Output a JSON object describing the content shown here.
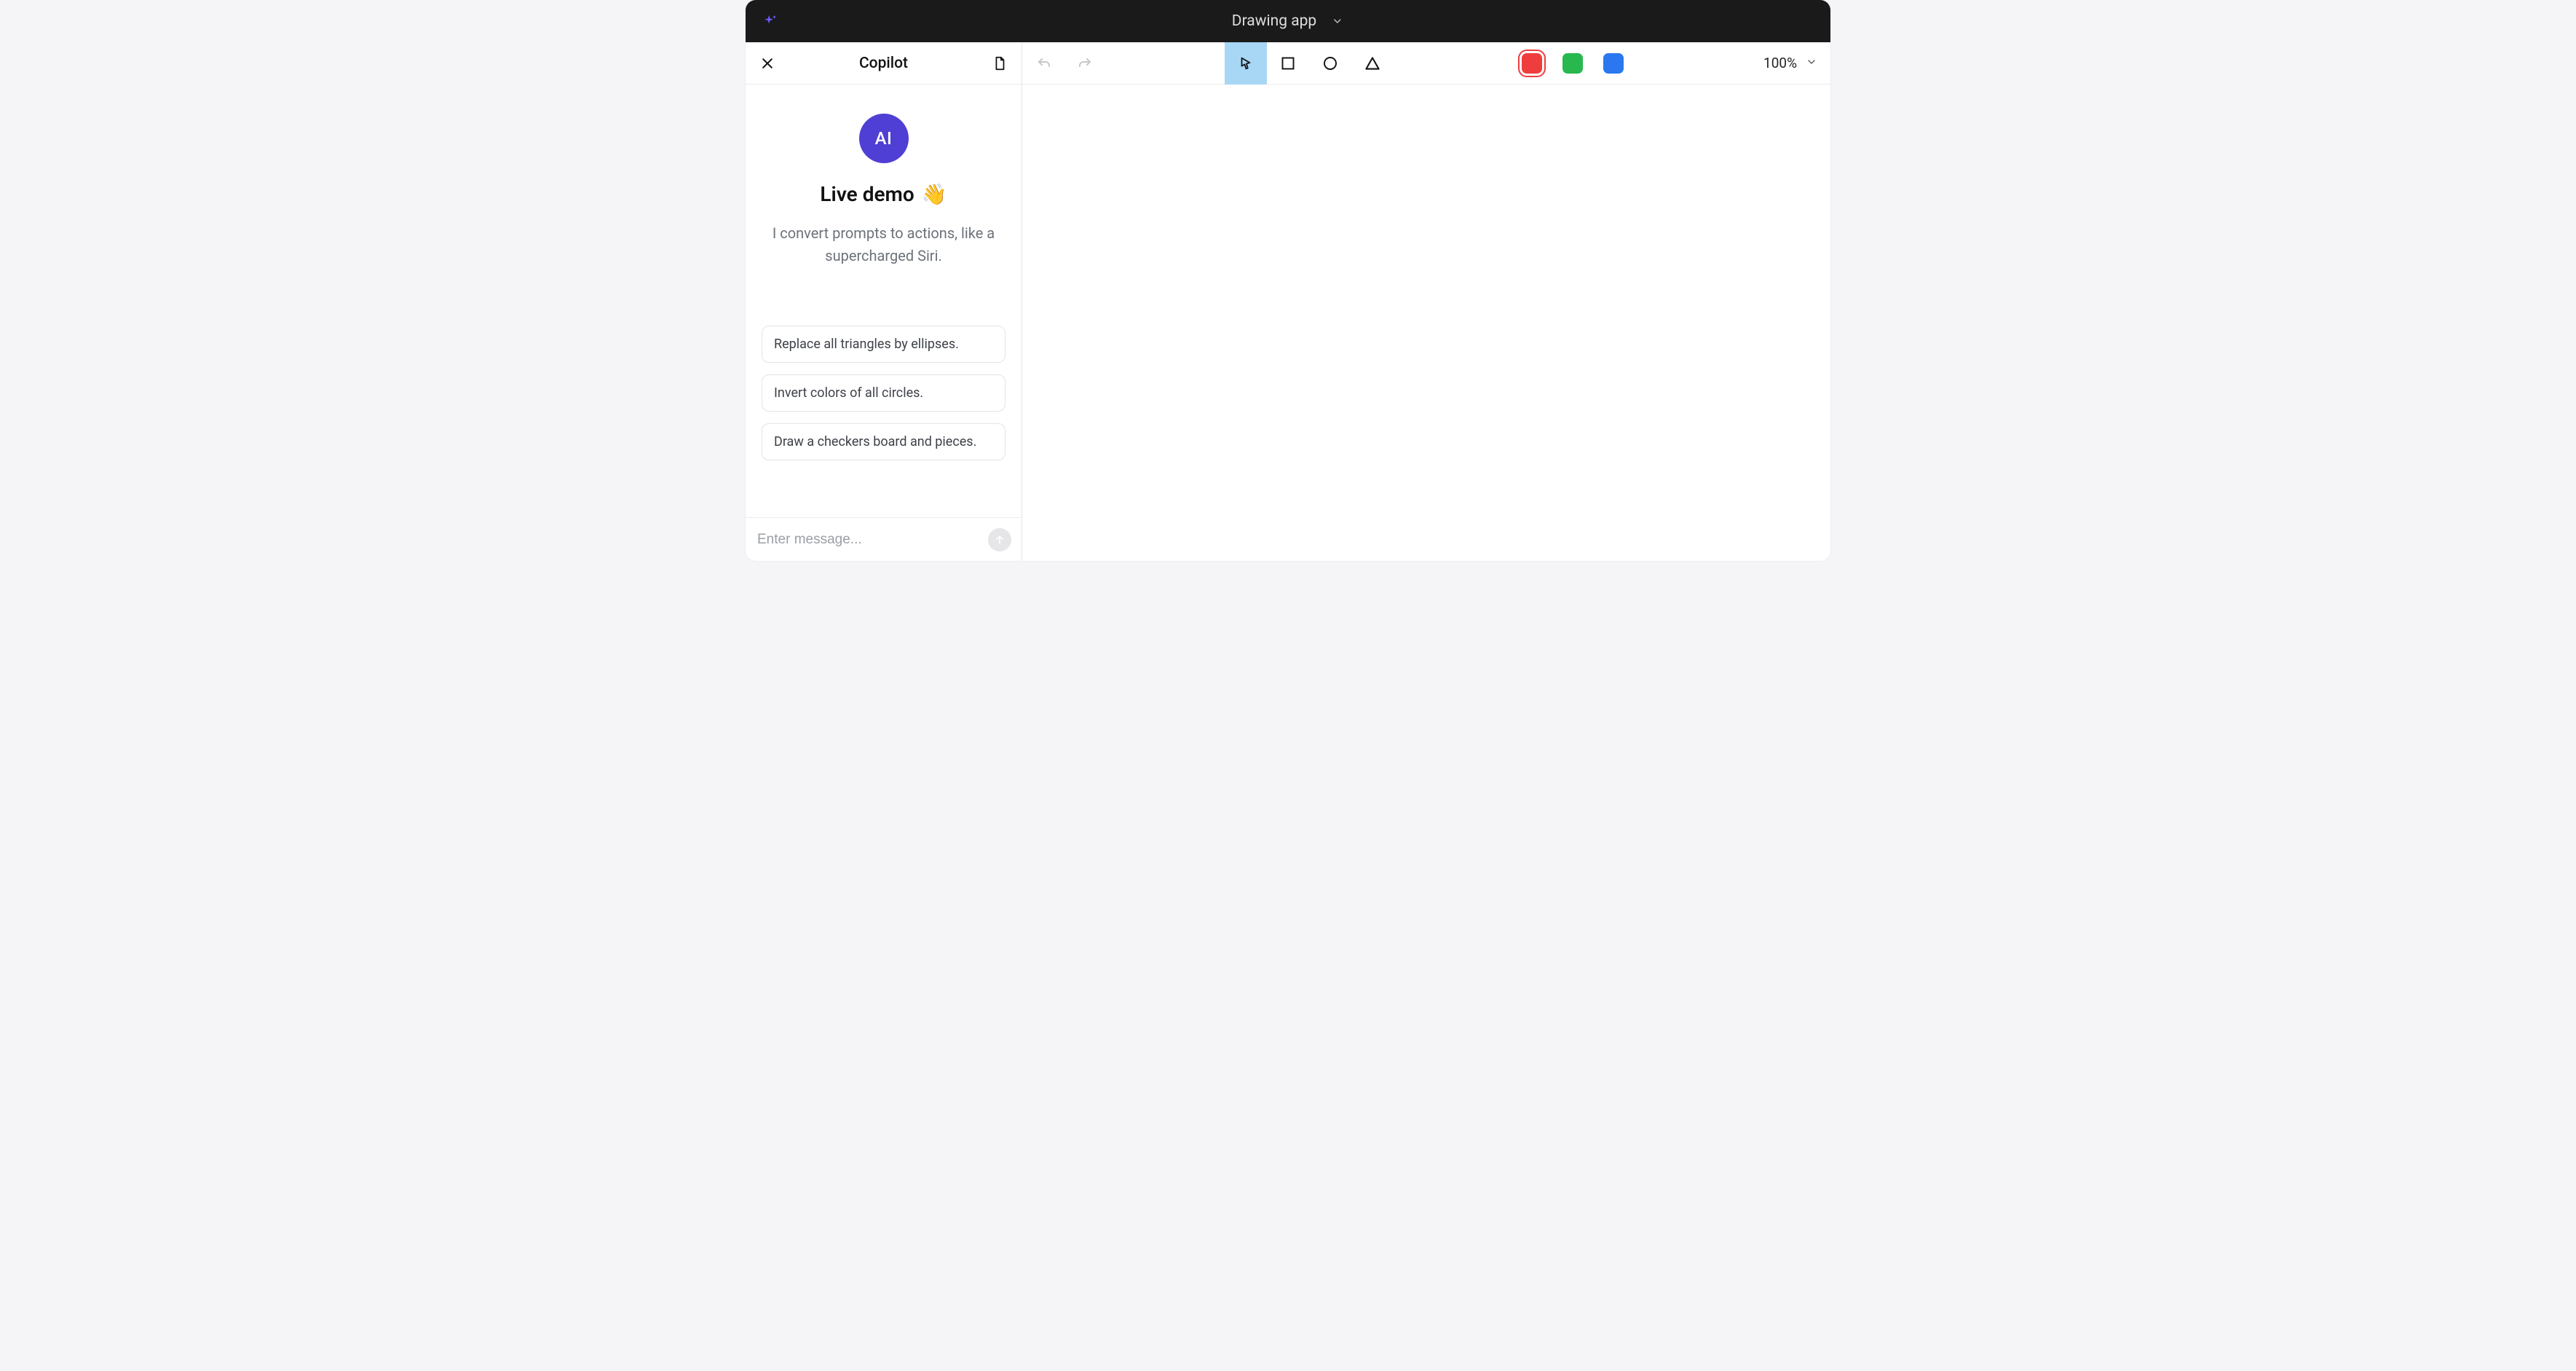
{
  "titlebar": {
    "title": "Drawing app"
  },
  "sidebar": {
    "title": "Copilot",
    "avatar_label": "AI",
    "welcome_title": "Live demo",
    "welcome_emoji": "👋",
    "welcome_subtitle": "I convert prompts to actions, like a supercharged Siri.",
    "suggestions": [
      "Replace all triangles by ellipses.",
      "Invert colors of all circles.",
      "Draw a checkers board and pieces."
    ],
    "composer_placeholder": "Enter message..."
  },
  "toolbar": {
    "tools": [
      {
        "id": "pointer",
        "active": true
      },
      {
        "id": "rectangle",
        "active": false
      },
      {
        "id": "circle",
        "active": false
      },
      {
        "id": "triangle",
        "active": false
      }
    ],
    "colors": [
      {
        "id": "red",
        "hex": "#ef3d3d",
        "selected": true
      },
      {
        "id": "green",
        "hex": "#28b84e",
        "selected": false
      },
      {
        "id": "blue",
        "hex": "#2a77ef",
        "selected": false
      }
    ],
    "zoom": "100%"
  }
}
